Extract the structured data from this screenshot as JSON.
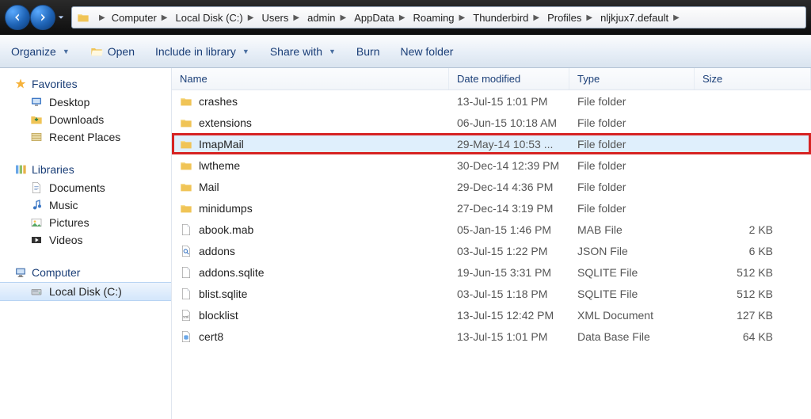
{
  "breadcrumb": [
    "Computer",
    "Local Disk (C:)",
    "Users",
    "admin",
    "AppData",
    "Roaming",
    "Thunderbird",
    "Profiles",
    "nljkjux7.default"
  ],
  "toolbar": {
    "organize": "Organize",
    "open": "Open",
    "include": "Include in library",
    "share": "Share with",
    "burn": "Burn",
    "newfolder": "New folder"
  },
  "sidebar": {
    "favorites_label": "Favorites",
    "favorites": [
      "Desktop",
      "Downloads",
      "Recent Places"
    ],
    "libraries_label": "Libraries",
    "libraries": [
      "Documents",
      "Music",
      "Pictures",
      "Videos"
    ],
    "computer_label": "Computer",
    "drives": [
      "Local Disk (C:)"
    ]
  },
  "columns": {
    "name": "Name",
    "date": "Date modified",
    "type": "Type",
    "size": "Size"
  },
  "files": [
    {
      "name": "crashes",
      "date": "13-Jul-15 1:01 PM",
      "type": "File folder",
      "size": "",
      "icon": "folder",
      "highlight": false
    },
    {
      "name": "extensions",
      "date": "06-Jun-15 10:18 AM",
      "type": "File folder",
      "size": "",
      "icon": "folder",
      "highlight": false
    },
    {
      "name": "ImapMail",
      "date": "29-May-14 10:53 ...",
      "type": "File folder",
      "size": "",
      "icon": "folder",
      "highlight": true
    },
    {
      "name": "lwtheme",
      "date": "30-Dec-14 12:39 PM",
      "type": "File folder",
      "size": "",
      "icon": "folder",
      "highlight": false
    },
    {
      "name": "Mail",
      "date": "29-Dec-14 4:36 PM",
      "type": "File folder",
      "size": "",
      "icon": "folder",
      "highlight": false
    },
    {
      "name": "minidumps",
      "date": "27-Dec-14 3:19 PM",
      "type": "File folder",
      "size": "",
      "icon": "folder",
      "highlight": false
    },
    {
      "name": "abook.mab",
      "date": "05-Jan-15 1:46 PM",
      "type": "MAB File",
      "size": "2 KB",
      "icon": "file",
      "highlight": false
    },
    {
      "name": "addons",
      "date": "03-Jul-15 1:22 PM",
      "type": "JSON File",
      "size": "6 KB",
      "icon": "search",
      "highlight": false
    },
    {
      "name": "addons.sqlite",
      "date": "19-Jun-15 3:31 PM",
      "type": "SQLITE File",
      "size": "512 KB",
      "icon": "file",
      "highlight": false
    },
    {
      "name": "blist.sqlite",
      "date": "03-Jul-15 1:18 PM",
      "type": "SQLITE File",
      "size": "512 KB",
      "icon": "file",
      "highlight": false
    },
    {
      "name": "blocklist",
      "date": "13-Jul-15 12:42 PM",
      "type": "XML Document",
      "size": "127 KB",
      "icon": "xml",
      "highlight": false
    },
    {
      "name": "cert8",
      "date": "13-Jul-15 1:01 PM",
      "type": "Data Base File",
      "size": "64 KB",
      "icon": "db",
      "highlight": false
    }
  ]
}
